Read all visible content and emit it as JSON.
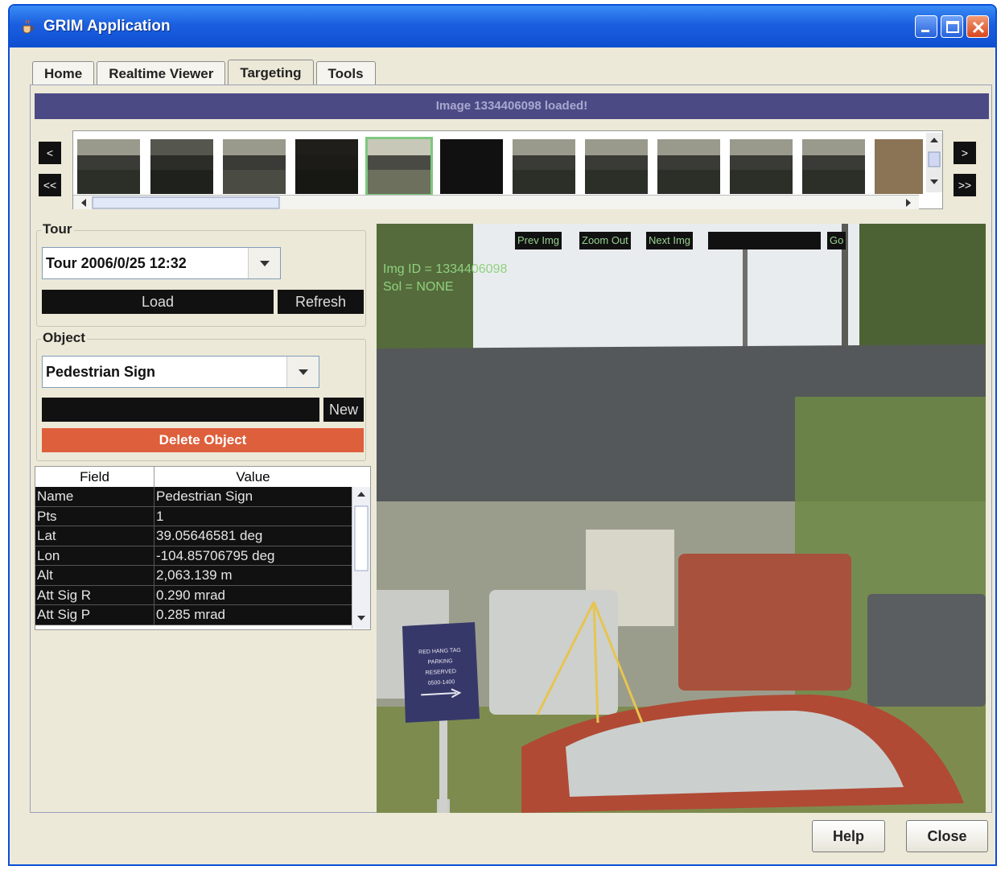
{
  "window": {
    "title": "GRIM Application"
  },
  "tabs": [
    {
      "label": "Home",
      "active": false
    },
    {
      "label": "Realtime Viewer",
      "active": false
    },
    {
      "label": "Targeting",
      "active": true
    },
    {
      "label": "Tools",
      "active": false
    }
  ],
  "status": {
    "message": "Image 1334406098 loaded!"
  },
  "filmstrip": {
    "prev_label": "<",
    "first_label": "<<",
    "next_label": ">",
    "last_label": ">>",
    "selected_index": 4,
    "thumbnail_count": 12
  },
  "tour": {
    "group_label": "Tour",
    "selected": "Tour 2006/0/25 12:32",
    "load_label": "Load",
    "refresh_label": "Refresh"
  },
  "object": {
    "group_label": "Object",
    "selected": "Pedestrian Sign",
    "name_input_value": "",
    "new_label": "New",
    "delete_label": "Delete Object"
  },
  "properties": {
    "columns": [
      "Field",
      "Value"
    ],
    "rows": [
      {
        "field": "Name",
        "value": "Pedestrian Sign"
      },
      {
        "field": "Pts",
        "value": "1"
      },
      {
        "field": "Lat",
        "value": "39.05646581 deg"
      },
      {
        "field": "Lon",
        "value": "-104.85706795 deg"
      },
      {
        "field": "Alt",
        "value": "2,063.139 m"
      },
      {
        "field": "Att Sig R",
        "value": "0.290 mrad"
      },
      {
        "field": "Att Sig P",
        "value": "0.285 mrad"
      }
    ]
  },
  "viewer": {
    "prev_img_label": "Prev Img",
    "zoom_out_label": "Zoom Out",
    "next_img_label": "Next Img",
    "goto_value": "",
    "go_label": "Go",
    "img_id_text": "Img ID = 1334406098",
    "sol_text": "Sol = NONE",
    "sign_text": [
      "RED HANG TAG",
      "PARKING",
      "RESERVED",
      "0500-1400"
    ]
  },
  "footer": {
    "help_label": "Help",
    "close_label": "Close"
  },
  "colors": {
    "title_bar": "#1b5fe0",
    "banner": "#4c4a84",
    "delete": "#de5f3c",
    "overlay_text": "#8fd27e",
    "selected_thumb": "#7ec87e"
  }
}
